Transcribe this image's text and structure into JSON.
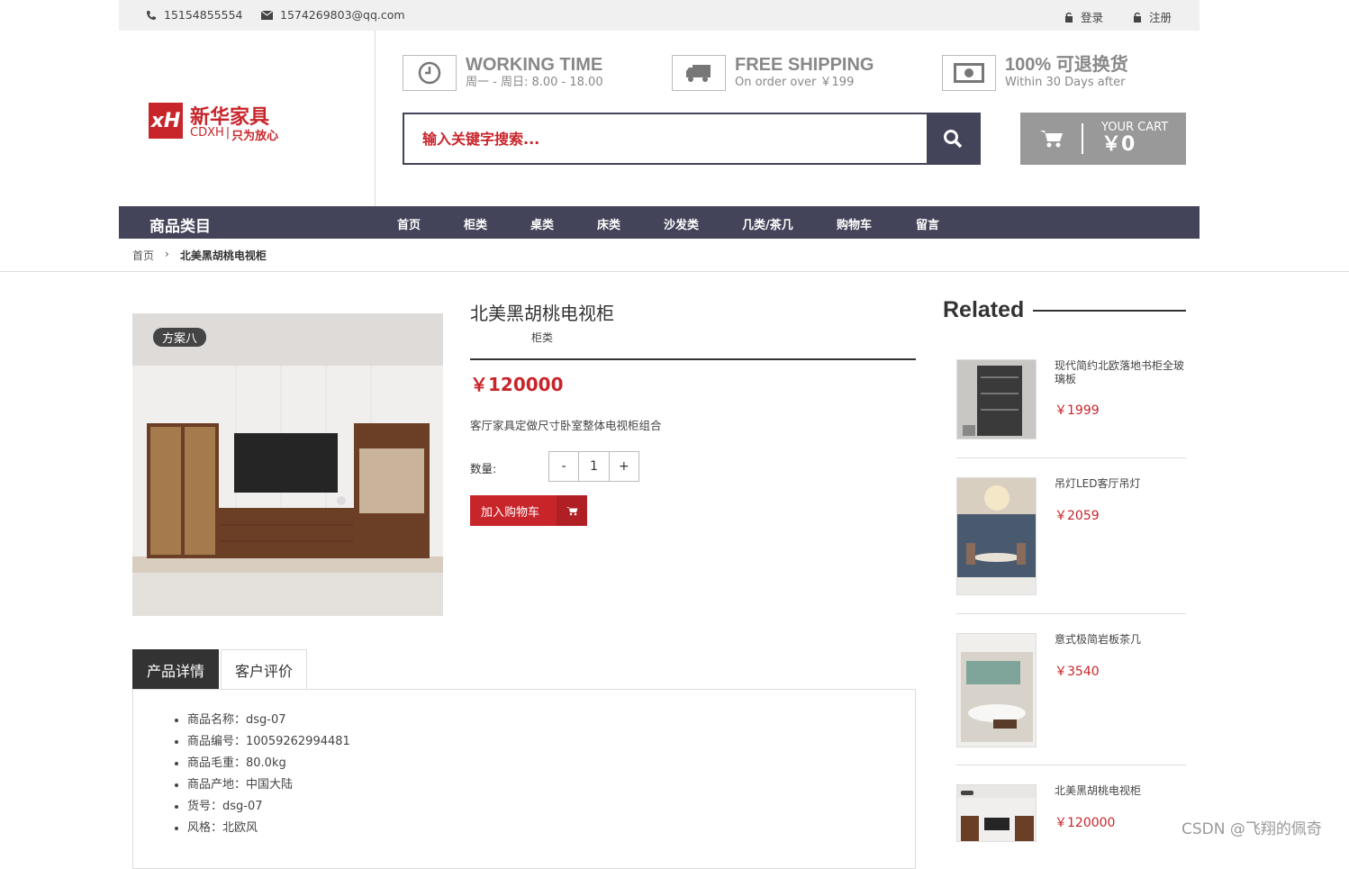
{
  "topbar": {
    "phone": "15154855554",
    "email": "1574269803@qq.com",
    "login": "登录",
    "register": "注册"
  },
  "logo": {
    "mark": "xH",
    "name": "新华家具",
    "sub_brand": "CDXH",
    "slogan": "只为放心"
  },
  "features": [
    {
      "title": "WORKING TIME",
      "sub": "周一 - 周日: 8.00 - 18.00",
      "icon": "clock-icon"
    },
    {
      "title": "FREE SHIPPING",
      "sub": "On order over ￥199",
      "icon": "truck-icon"
    },
    {
      "title": "100% 可退换货",
      "sub": "Within 30 Days after",
      "icon": "money-icon"
    }
  ],
  "search": {
    "placeholder": "输入关键字搜索..."
  },
  "cart": {
    "label": "YOUR CART",
    "amount": "￥0"
  },
  "nav": {
    "category": "商品类目",
    "items": [
      "首页",
      "柜类",
      "桌类",
      "床类",
      "沙发类",
      "几类/茶几",
      "购物车",
      "留言"
    ]
  },
  "breadcrumb": {
    "home": "首页",
    "current": "北美黑胡桃电视柜"
  },
  "product": {
    "badge": "方案八",
    "title": "北美黑胡桃电视柜",
    "category": "柜类",
    "price": "￥120000",
    "description": "客厅家具定做尺寸卧室整体电视柜组合",
    "qty_label": "数量:",
    "qty_minus": "-",
    "qty_value": "1",
    "qty_plus": "+",
    "add_to_cart": "加入购物车"
  },
  "tabs": {
    "items": [
      "产品详情",
      "客户评价"
    ],
    "details": [
      "商品名称：dsg-07",
      "商品编号：10059262994481",
      "商品毛重：80.0kg",
      "商品产地：中国大陆",
      "货号：dsg-07",
      "风格：北欧风"
    ]
  },
  "related": {
    "title": "Related",
    "items": [
      {
        "name": "现代简约北欧落地书柜全玻璃板",
        "price": "￥1999"
      },
      {
        "name": "吊灯LED客厅吊灯",
        "price": "￥2059"
      },
      {
        "name": "意式极简岩板茶几",
        "price": "￥3540"
      },
      {
        "name": "北美黑胡桃电视柜",
        "price": "￥120000"
      }
    ]
  },
  "watermark": "CSDN @飞翔的佩奇"
}
